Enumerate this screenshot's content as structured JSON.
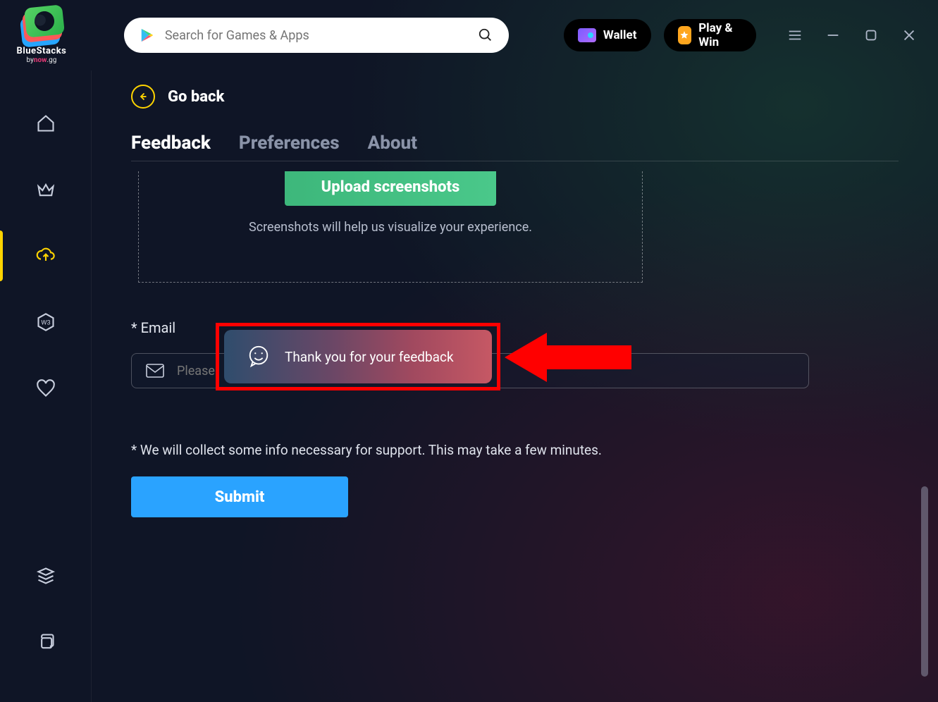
{
  "brand": {
    "name": "BlueStacks",
    "byline_prefix": "by",
    "byline_brand": "now",
    "byline_suffix": ".gg"
  },
  "search": {
    "placeholder": "Search for Games & Apps"
  },
  "header": {
    "wallet_label": "Wallet",
    "playwin_label": "Play & Win"
  },
  "nav": {
    "goback": "Go back",
    "tabs": {
      "feedback": "Feedback",
      "preferences": "Preferences",
      "about": "About"
    }
  },
  "form": {
    "upload_button": "Upload screenshots",
    "upload_hint": "Screenshots will help us visualize your experience.",
    "email_label": "* Email",
    "email_placeholder": "Please",
    "disclaimer": "* We will collect some info necessary for support. This may take a few minutes.",
    "submit": "Submit"
  },
  "toast": {
    "message": "Thank you for your feedback"
  }
}
